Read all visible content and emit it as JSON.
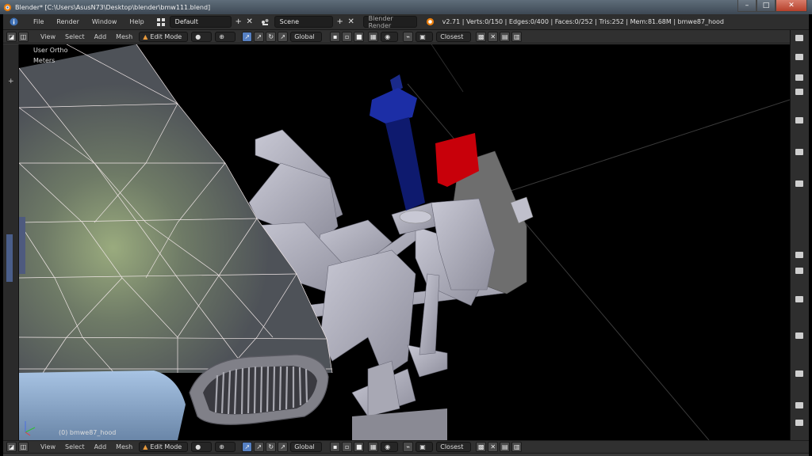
{
  "window": {
    "title": "Blender* [C:\\Users\\AsusN73\\Desktop\\blender\\bmw111.blend]",
    "minimize_glyph": "–",
    "maximize_glyph": "□",
    "close_glyph": "✕"
  },
  "info_header": {
    "menus": [
      "File",
      "Render",
      "Window",
      "Help"
    ],
    "layout": "Default",
    "scene": "Scene",
    "engine": "Blender Render",
    "stats": "v2.71 | Verts:0/150 | Edges:0/400 | Faces:0/252 | Tris:252 | Mem:81.68M | bmwe87_hood",
    "add_glyph": "+",
    "remove_glyph": "✕"
  },
  "view_header": {
    "menus": [
      "View",
      "Select",
      "Add",
      "Mesh"
    ],
    "mode": "Edit Mode",
    "orientation": "Global",
    "snap": "Closest"
  },
  "viewport": {
    "view_name": "User Ortho",
    "units": "Meters",
    "object_label": "(0) bmwe87_hood",
    "left_clip_top": "Us",
    "left_clip_bottom": "Me"
  },
  "colors": {
    "accent_blue": "#5680c2",
    "red_part": "#c8000a",
    "navy_part": "#1a2a8a"
  }
}
